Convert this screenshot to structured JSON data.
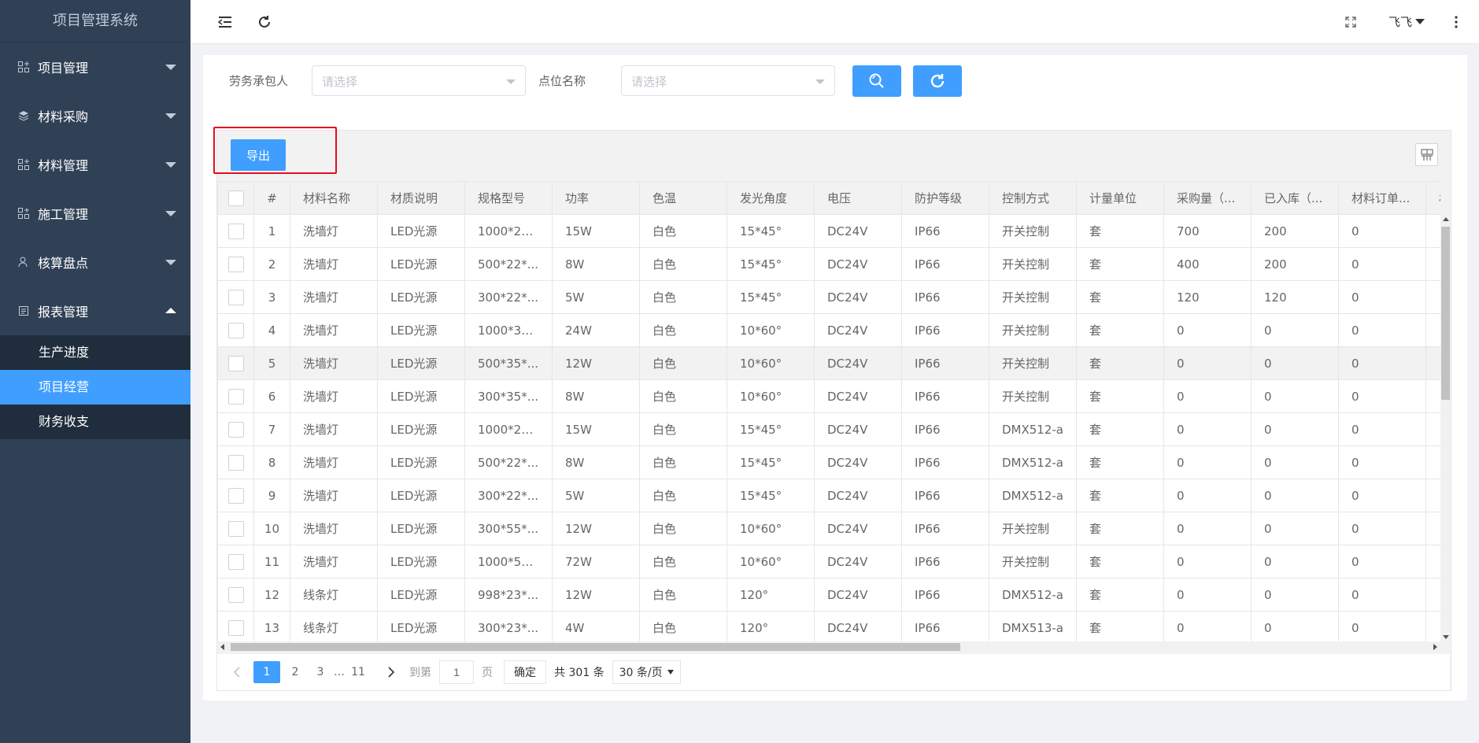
{
  "app": {
    "title": "项目管理系统"
  },
  "sidebar": {
    "items": [
      {
        "label": "项目管理",
        "icon": "grid-plus-icon"
      },
      {
        "label": "材料采购",
        "icon": "layers-icon"
      },
      {
        "label": "材料管理",
        "icon": "grid-plus-icon"
      },
      {
        "label": "施工管理",
        "icon": "grid-plus-icon"
      },
      {
        "label": "核算盘点",
        "icon": "user-check-icon"
      },
      {
        "label": "报表管理",
        "icon": "document-icon"
      }
    ],
    "submenu": [
      "生产进度",
      "项目经营",
      "财务收支"
    ]
  },
  "header": {
    "user": "飞飞"
  },
  "filters": {
    "contractor_label": "劳务承包人",
    "contractor_placeholder": "请选择",
    "location_label": "点位名称",
    "location_placeholder": "请选择"
  },
  "toolbar": {
    "export_label": "导出"
  },
  "table": {
    "columns": [
      "#",
      "材料名称",
      "材质说明",
      "规格型号",
      "功率",
      "色温",
      "发光角度",
      "电压",
      "防护等级",
      "控制方式",
      "计量单位",
      "采购量（...",
      "已入库（...",
      "材料订单...",
      "材"
    ],
    "rows": [
      [
        "1",
        "洗墙灯",
        "LED光源",
        "1000*22...",
        "15W",
        "白色",
        "15*45°",
        "DC24V",
        "IP66",
        "开关控制",
        "套",
        "700",
        "200",
        "0",
        ""
      ],
      [
        "2",
        "洗墙灯",
        "LED光源",
        "500*22*...",
        "8W",
        "白色",
        "15*45°",
        "DC24V",
        "IP66",
        "开关控制",
        "套",
        "400",
        "200",
        "0",
        ""
      ],
      [
        "3",
        "洗墙灯",
        "LED光源",
        "300*22*...",
        "5W",
        "白色",
        "15*45°",
        "DC24V",
        "IP66",
        "开关控制",
        "套",
        "120",
        "120",
        "0",
        ""
      ],
      [
        "4",
        "洗墙灯",
        "LED光源",
        "1000*35...",
        "24W",
        "白色",
        "10*60°",
        "DC24V",
        "IP66",
        "开关控制",
        "套",
        "0",
        "0",
        "0",
        ""
      ],
      [
        "5",
        "洗墙灯",
        "LED光源",
        "500*35*...",
        "12W",
        "白色",
        "10*60°",
        "DC24V",
        "IP66",
        "开关控制",
        "套",
        "0",
        "0",
        "0",
        ""
      ],
      [
        "6",
        "洗墙灯",
        "LED光源",
        "300*35*...",
        "8W",
        "白色",
        "10*60°",
        "DC24V",
        "IP66",
        "开关控制",
        "套",
        "0",
        "0",
        "0",
        ""
      ],
      [
        "7",
        "洗墙灯",
        "LED光源",
        "1000*22...",
        "15W",
        "白色",
        "15*45°",
        "DC24V",
        "IP66",
        "DMX512-a",
        "套",
        "0",
        "0",
        "0",
        ""
      ],
      [
        "8",
        "洗墙灯",
        "LED光源",
        "500*22*...",
        "8W",
        "白色",
        "15*45°",
        "DC24V",
        "IP66",
        "DMX512-a",
        "套",
        "0",
        "0",
        "0",
        ""
      ],
      [
        "9",
        "洗墙灯",
        "LED光源",
        "300*22*...",
        "5W",
        "白色",
        "15*45°",
        "DC24V",
        "IP66",
        "DMX512-a",
        "套",
        "0",
        "0",
        "0",
        ""
      ],
      [
        "10",
        "洗墙灯",
        "LED光源",
        "300*55*...",
        "12W",
        "白色",
        "10*60°",
        "DC24V",
        "IP66",
        "开关控制",
        "套",
        "0",
        "0",
        "0",
        ""
      ],
      [
        "11",
        "洗墙灯",
        "LED光源",
        "1000*55...",
        "72W",
        "白色",
        "10*60°",
        "DC24V",
        "IP66",
        "开关控制",
        "套",
        "0",
        "0",
        "0",
        ""
      ],
      [
        "12",
        "线条灯",
        "LED光源",
        "998*23*...",
        "12W",
        "白色",
        "120°",
        "DC24V",
        "IP66",
        "DMX512-a",
        "套",
        "0",
        "0",
        "0",
        ""
      ],
      [
        "13",
        "线条灯",
        "LED光源",
        "300*23*...",
        "4W",
        "白色",
        "120°",
        "DC24V",
        "IP66",
        "DMX513-a",
        "套",
        "0",
        "0",
        "0",
        ""
      ]
    ]
  },
  "pagination": {
    "pages": [
      "1",
      "2",
      "3",
      "…",
      "11"
    ],
    "current": "1",
    "goto_label": "到第",
    "goto_value": "1",
    "page_unit": "页",
    "confirm_label": "确定",
    "total": "共 301 条",
    "page_size": "30 条/页"
  },
  "colors": {
    "accent": "#409eff",
    "sidebar": "#304156",
    "highlight": "#e3101d"
  }
}
